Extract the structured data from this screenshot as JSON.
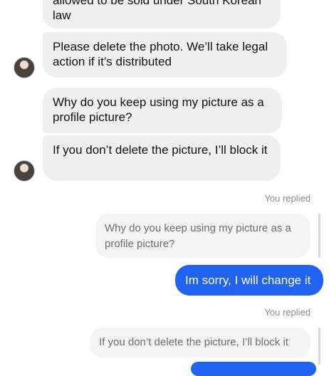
{
  "thread": {
    "messages_in": [
      {
        "text": "allowed to be sold under South Korean law"
      },
      {
        "text": "Please delete the photo. We’ll take legal action if it’s distributed"
      },
      {
        "text": "Why do you keep using my picture as a profile picture?"
      },
      {
        "text": "If you don’t delete the picture, I’ll block it"
      }
    ],
    "reply_1": {
      "label": "You replied",
      "quoted": "Why do you keep using my picture as a profile picture?",
      "message": "Im sorry, I will change it"
    },
    "reply_2": {
      "label": "You replied",
      "quoted": "If you don’t delete the picture, I’ll block it"
    }
  }
}
